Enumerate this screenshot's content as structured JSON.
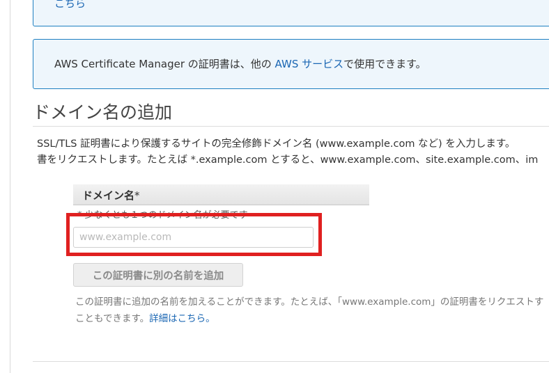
{
  "top_box": {
    "link": "こちら"
  },
  "info": {
    "prefix": "AWS Certificate Manager の証明書は、他の ",
    "link": "AWS サービス",
    "suffix": "で使用できます。"
  },
  "section": {
    "title": "ドメイン名の追加",
    "desc_line1": "SSL/TLS 証明書により保護するサイトの完全修飾ドメイン名 (www.example.com など) を入力します。",
    "desc_line2": "書をリクエストします。たとえば *.example.com とすると、www.example.com、site.example.com、im"
  },
  "field": {
    "label": "ドメイン名",
    "required_mark": "*",
    "hint": "* 少なくとも１つのドメイン名が必要です",
    "placeholder": "www.example.com",
    "value": ""
  },
  "add_name_button": "この証明書に別の名前を追加",
  "help": {
    "line1": "この証明書に追加の名前を加えることができます。たとえば、「www.example.com」の証明書をリクエストす",
    "line2_prefix": "こともできます。",
    "link": "詳細はこちら。"
  },
  "colors": {
    "accent": "#1a66b3",
    "info_bg": "#eef6fc",
    "highlight": "#e02020"
  }
}
